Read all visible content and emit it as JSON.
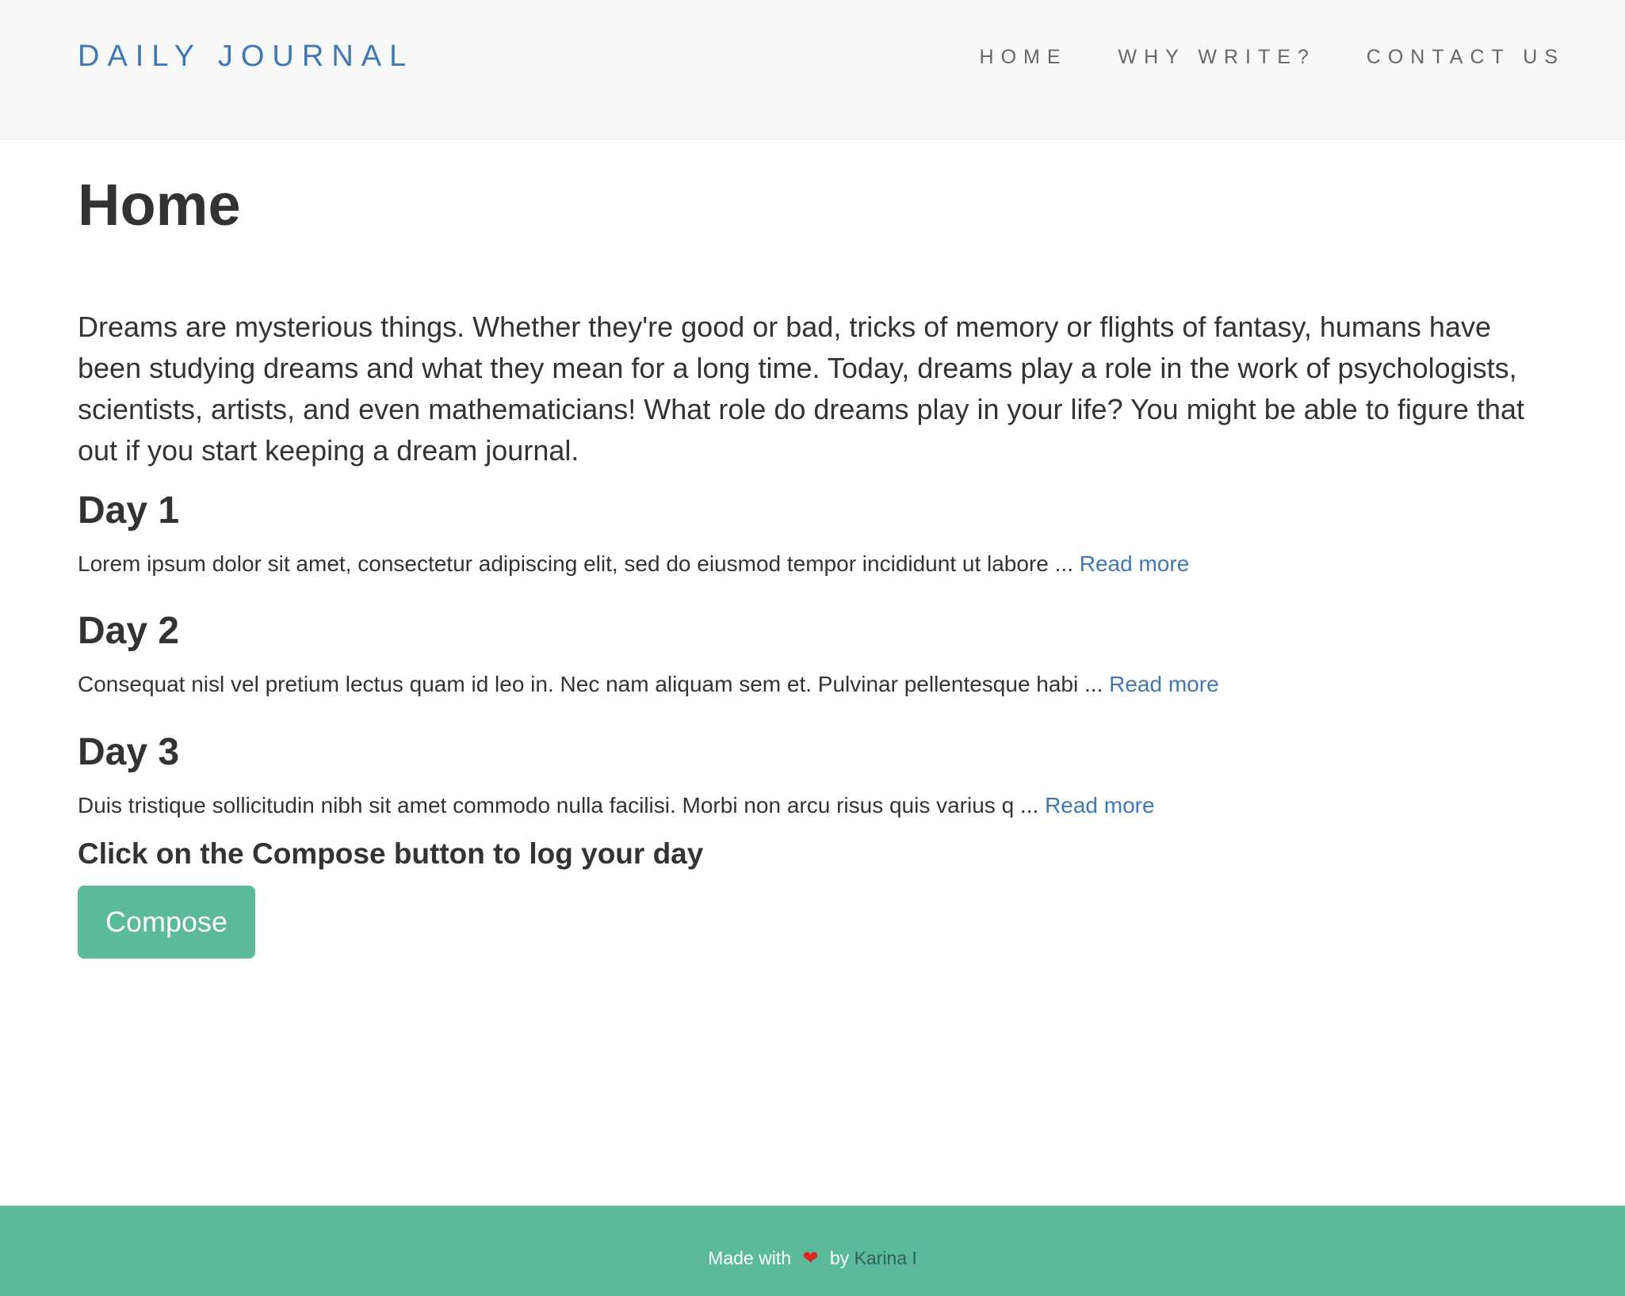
{
  "navbar": {
    "brand": "DAILY JOURNAL",
    "links": [
      "HOME",
      "WHY WRITE?",
      "CONTACT US"
    ]
  },
  "main": {
    "title": "Home",
    "intro": "Dreams are mysterious things. Whether they're good or bad, tricks of memory or flights of fantasy, humans have been studying dreams and what they mean for a long time. Today, dreams play a role in the work of psychologists, scientists, artists, and even mathematicians! What role do dreams play in your life? You might be able to figure that out if you start keeping a dream journal.",
    "posts": [
      {
        "title": "Day 1",
        "excerpt": "Lorem ipsum dolor sit amet, consectetur adipiscing elit, sed do eiusmod tempor incididunt ut labore ...",
        "read_more": "Read more"
      },
      {
        "title": "Day 2",
        "excerpt": "Consequat nisl vel pretium lectus quam id leo in. Nec nam aliquam sem et. Pulvinar pellentesque habi ...",
        "read_more": "Read more"
      },
      {
        "title": "Day 3",
        "excerpt": "Duis tristique sollicitudin nibh sit amet commodo nulla facilisi. Morbi non arcu risus quis varius q ...",
        "read_more": "Read more"
      }
    ],
    "compose_prompt": "Click on the Compose button to log your day",
    "compose_button": "Compose"
  },
  "footer": {
    "made_with": "Made with",
    "heart_icon": "❤",
    "by": "by",
    "author": "Karina I"
  },
  "colors": {
    "brand": "#3f78b5",
    "accent": "#5bba9b",
    "navbar_bg": "#f8f8f8",
    "heart": "#e02424"
  }
}
